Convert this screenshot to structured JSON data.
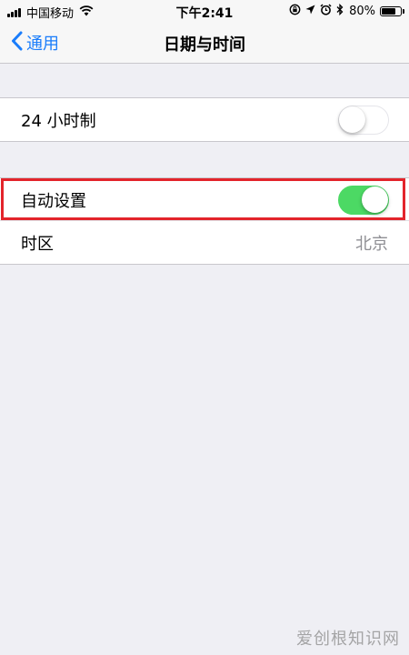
{
  "status_bar": {
    "carrier": "中国移动",
    "time": "下午2:41",
    "battery_percent": "80%",
    "battery_level": 0.8
  },
  "nav": {
    "back_label": "通用",
    "title": "日期与时间"
  },
  "settings": {
    "hour24": {
      "label": "24 小时制",
      "enabled": false
    },
    "auto_set": {
      "label": "自动设置",
      "enabled": true
    },
    "timezone": {
      "label": "时区",
      "value": "北京"
    }
  },
  "colors": {
    "accent": "#1a7dfb",
    "toggle_on": "#4cd964",
    "highlight": "#e3242b",
    "background": "#efeff4"
  },
  "watermark": "爱创根知识网"
}
